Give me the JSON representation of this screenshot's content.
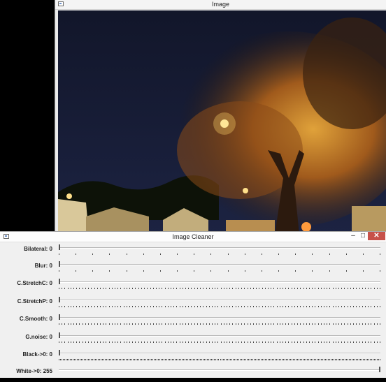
{
  "image_window": {
    "title": "Image",
    "icon": "window-app-icon"
  },
  "cleaner_window": {
    "title": "Image Cleaner",
    "icon": "window-app-icon",
    "controls": {
      "minimize": "–",
      "maximize": "□",
      "close": "✕"
    },
    "sliders": [
      {
        "label": "Bilateral: 0",
        "value": 0,
        "max": 10,
        "ticks": 20
      },
      {
        "label": "Blur: 0",
        "value": 0,
        "max": 20,
        "ticks": 20
      },
      {
        "label": "C.StretchC: 0",
        "value": 0,
        "max": 100,
        "ticks": 110
      },
      {
        "label": "C.StretchP: 0",
        "value": 0,
        "max": 100,
        "ticks": 110
      },
      {
        "label": "C.Smooth: 0",
        "value": 0,
        "max": 100,
        "ticks": 110
      },
      {
        "label": "G.noise: 0",
        "value": 0,
        "max": 100,
        "ticks": 110
      },
      {
        "label": "Black->0: 0",
        "value": 0,
        "max": 255,
        "ticks": 230
      },
      {
        "label": "White->0: 255",
        "value": 255,
        "max": 255,
        "ticks": 0
      }
    ]
  },
  "colors": {
    "close_button": "#c7514a",
    "sky": "#161a2c",
    "tree_glow": "#c8862a"
  }
}
